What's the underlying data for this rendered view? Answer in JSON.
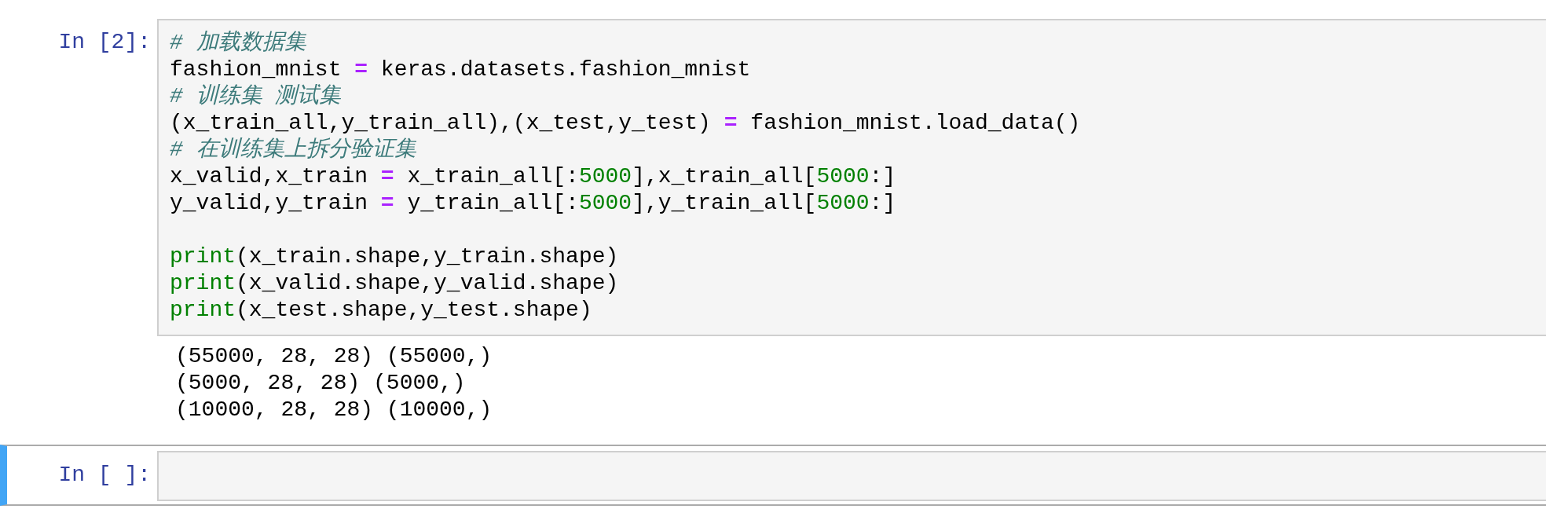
{
  "cells": [
    {
      "prompt": "In [2]:",
      "selected": false,
      "input": [
        {
          "kind": "code",
          "tokens": [
            {
              "kind": "comment",
              "text": "# 加载数据集"
            }
          ]
        },
        {
          "kind": "code",
          "tokens": [
            {
              "kind": "text",
              "text": "fashion_mnist "
            },
            {
              "kind": "operator",
              "text": "="
            },
            {
              "kind": "text",
              "text": " keras.datasets.fashion_mnist"
            }
          ]
        },
        {
          "kind": "code",
          "tokens": [
            {
              "kind": "comment",
              "text": "# 训练集 测试集"
            }
          ]
        },
        {
          "kind": "code",
          "tokens": [
            {
              "kind": "text",
              "text": "(x_train_all,y_train_all),(x_test,y_test) "
            },
            {
              "kind": "operator",
              "text": "="
            },
            {
              "kind": "text",
              "text": " fashion_mnist.load_data()"
            }
          ]
        },
        {
          "kind": "code",
          "tokens": [
            {
              "kind": "comment",
              "text": "# 在训练集上拆分验证集"
            }
          ]
        },
        {
          "kind": "code",
          "tokens": [
            {
              "kind": "text",
              "text": "x_valid,x_train "
            },
            {
              "kind": "operator",
              "text": "="
            },
            {
              "kind": "text",
              "text": " x_train_all[:"
            },
            {
              "kind": "number",
              "text": "5000"
            },
            {
              "kind": "text",
              "text": "],x_train_all["
            },
            {
              "kind": "number",
              "text": "5000"
            },
            {
              "kind": "text",
              "text": ":]"
            }
          ]
        },
        {
          "kind": "code",
          "tokens": [
            {
              "kind": "text",
              "text": "y_valid,y_train "
            },
            {
              "kind": "operator",
              "text": "="
            },
            {
              "kind": "text",
              "text": " y_train_all[:"
            },
            {
              "kind": "number",
              "text": "5000"
            },
            {
              "kind": "text",
              "text": "],y_train_all["
            },
            {
              "kind": "number",
              "text": "5000"
            },
            {
              "kind": "text",
              "text": ":]"
            }
          ]
        },
        {
          "kind": "blank"
        },
        {
          "kind": "code",
          "tokens": [
            {
              "kind": "builtin",
              "text": "print"
            },
            {
              "kind": "text",
              "text": "(x_train.shape,y_train.shape)"
            }
          ]
        },
        {
          "kind": "code",
          "tokens": [
            {
              "kind": "builtin",
              "text": "print"
            },
            {
              "kind": "text",
              "text": "(x_valid.shape,y_valid.shape)"
            }
          ]
        },
        {
          "kind": "code",
          "tokens": [
            {
              "kind": "builtin",
              "text": "print"
            },
            {
              "kind": "text",
              "text": "(x_test.shape,y_test.shape)"
            }
          ]
        }
      ],
      "output": [
        "(55000, 28, 28) (55000,)",
        "(5000, 28, 28) (5000,)",
        "(10000, 28, 28) (10000,)"
      ]
    },
    {
      "prompt": "In [ ]:",
      "selected": true
    }
  ]
}
